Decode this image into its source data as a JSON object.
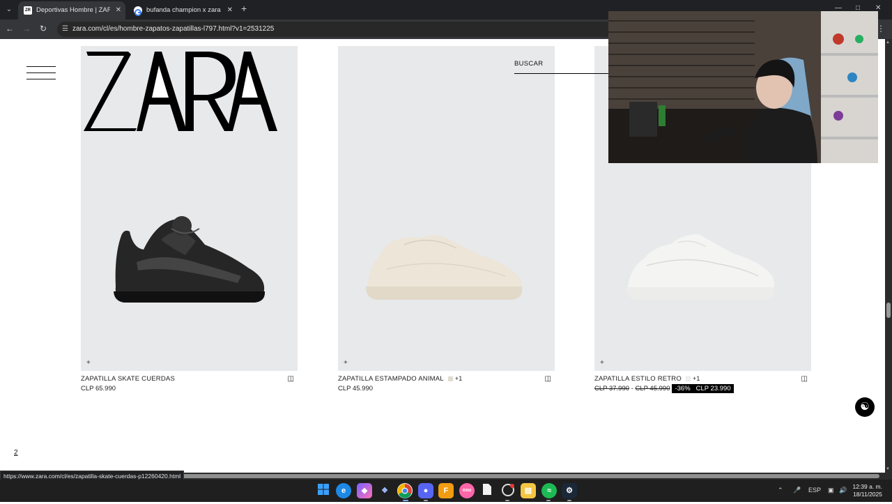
{
  "browser": {
    "tabs": [
      {
        "title": "Deportivas Hombre | ZARA Chile",
        "active": true,
        "favicon": "zara-favicon"
      },
      {
        "title": "bufanda champion x zara - Busca",
        "active": false,
        "favicon": "google-favicon"
      }
    ],
    "new_tab_symbol": "+",
    "url": "zara.com/cl/es/hombre-zapatos-zapatillas-l797.html?v1=2531225",
    "status_url": "https://www.zara.com/cl/es/zapatilla-skate-cuerdas-p12260420.html"
  },
  "site": {
    "logo": "ZARA",
    "search_label": "BUSCAR",
    "products": [
      {
        "name": "ZAPATILLA SKATE CUERDAS",
        "price": "CLP 65.990",
        "shoe_color": "#2a2a2a",
        "extra_colors": ""
      },
      {
        "name": "ZAPATILLA ESTAMPADO ANIMAL",
        "price": "CLP 45.990",
        "shoe_color": "#ebe6dc",
        "extra_colors": "+1",
        "swatch": "#e0dbcf"
      },
      {
        "name": "ZAPATILLA ESTILO RETRO",
        "old_price_1": "CLP 37.990",
        "separator": "-",
        "old_price_2": "CLP 45.990",
        "discount": "-36%",
        "price": "CLP 23.990",
        "shoe_color": "#f1f1f0",
        "extra_colors": "+1",
        "swatch": "#f1f1f1"
      }
    ],
    "pagination": "2",
    "plus_symbol": "+"
  },
  "taskbar": {
    "language": "ESP",
    "time": "12:39 a. m.",
    "date": "18/11/2025",
    "apps": [
      "windows-start",
      "edge",
      "copilot",
      "vscode",
      "chrome",
      "discord",
      "fl-studio",
      "osu",
      "file",
      "explorer",
      "spotify",
      "obs",
      "steam"
    ]
  },
  "colors": {
    "tabbar": "#202124",
    "page_bg": "#ffffff",
    "product_bg": "#e7e9eb",
    "discount_bg": "#000000"
  }
}
